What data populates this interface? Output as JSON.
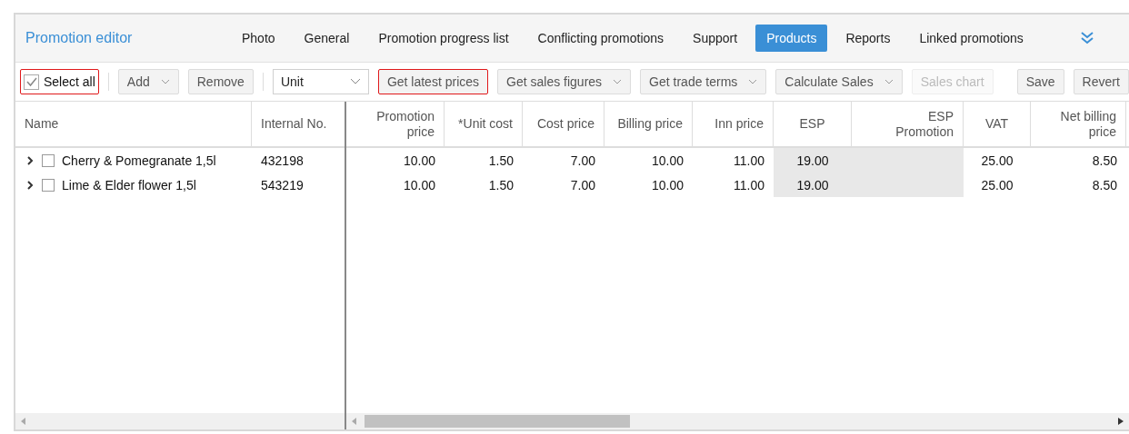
{
  "title": "Promotion editor",
  "tabs": [
    {
      "label": "Photo",
      "selected": false
    },
    {
      "label": "General",
      "selected": false
    },
    {
      "label": "Promotion progress list",
      "selected": false
    },
    {
      "label": "Conflicting promotions",
      "selected": false
    },
    {
      "label": "Support",
      "selected": false
    },
    {
      "label": "Products",
      "selected": true
    },
    {
      "label": "Reports",
      "selected": false
    },
    {
      "label": "Linked promotions",
      "selected": false
    }
  ],
  "toolbar": [
    {
      "kind": "checkbox",
      "label": "Select all",
      "checked": true,
      "highlighted": true
    },
    {
      "kind": "separator"
    },
    {
      "kind": "button",
      "label": "Add",
      "dropdown": true,
      "disabled": false,
      "highlighted": false
    },
    {
      "kind": "button",
      "label": "Remove",
      "dropdown": false,
      "disabled": false,
      "highlighted": false
    },
    {
      "kind": "separator"
    },
    {
      "kind": "select",
      "value": "Unit"
    },
    {
      "kind": "button",
      "label": "Get latest prices",
      "dropdown": false,
      "disabled": false,
      "highlighted": true
    },
    {
      "kind": "button",
      "label": "Get sales figures",
      "dropdown": true,
      "disabled": false,
      "highlighted": false
    },
    {
      "kind": "button",
      "label": "Get trade terms",
      "dropdown": true,
      "disabled": false,
      "highlighted": false
    },
    {
      "kind": "button",
      "label": "Calculate Sales",
      "dropdown": true,
      "disabled": false,
      "highlighted": false
    },
    {
      "kind": "button",
      "label": "Sales chart",
      "dropdown": false,
      "disabled": true,
      "highlighted": false
    },
    {
      "kind": "gap"
    },
    {
      "kind": "button",
      "label": "Save",
      "dropdown": false,
      "disabled": false,
      "highlighted": false
    },
    {
      "kind": "button",
      "label": "Revert",
      "dropdown": false,
      "disabled": false,
      "highlighted": false
    }
  ],
  "fixed_columns": [
    "Name",
    "Internal No."
  ],
  "columns": [
    {
      "label": "Promotion price",
      "shaded": false
    },
    {
      "label": "*Unit cost",
      "shaded": false
    },
    {
      "label": "Cost price",
      "shaded": false
    },
    {
      "label": "Billing price",
      "shaded": false
    },
    {
      "label": "Inn price",
      "shaded": false
    },
    {
      "label": "ESP",
      "shaded": true
    },
    {
      "label": "ESP Promotion",
      "shaded": true
    },
    {
      "label": "VAT",
      "shaded": false
    },
    {
      "label": "Net billing price",
      "shaded": false
    }
  ],
  "rows": [
    {
      "name": "Cherry & Pomegranate 1,5l",
      "internal_no": "432198",
      "checked": false,
      "expanded": false,
      "cells": [
        {
          "value": "10.00"
        },
        {
          "value": "1.50"
        },
        {
          "value": "7.00"
        },
        {
          "value": "10.00"
        },
        {
          "value": "11.00"
        },
        {
          "value": "19.00"
        },
        {},
        {
          "value": "25.00"
        },
        {
          "value": "8.50"
        }
      ]
    },
    {
      "name": "Lime & Elder flower 1,5l",
      "internal_no": "543219",
      "checked": false,
      "expanded": false,
      "cells": [
        {
          "value": "10.00"
        },
        {
          "value": "1.50"
        },
        {
          "value": "7.00"
        },
        {
          "value": "10.00"
        },
        {
          "value": "11.00"
        },
        {
          "value": "19.00"
        },
        {},
        {
          "value": "25.00"
        },
        {
          "value": "8.50"
        }
      ]
    }
  ]
}
